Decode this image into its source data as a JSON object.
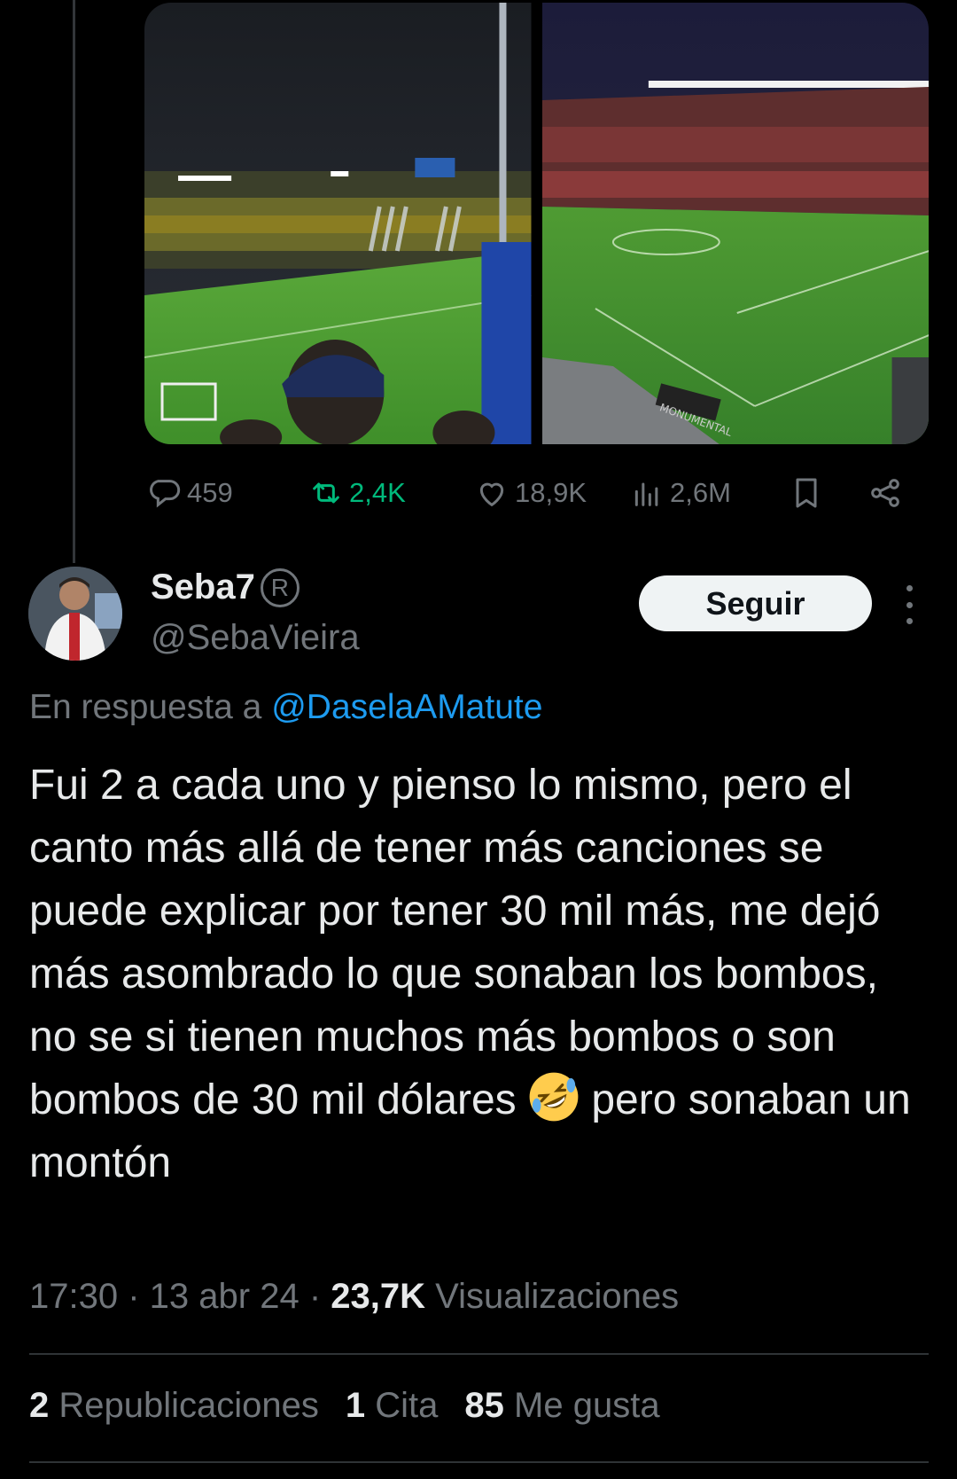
{
  "parent_tweet": {
    "actions": {
      "replies": "459",
      "retweets": "2,4K",
      "likes": "18,9K",
      "views": "2,6M"
    },
    "media_banner_text": "MONUMENTAL"
  },
  "tweet": {
    "display_name": "Seba7",
    "badge": "R",
    "handle": "@SebaVieira",
    "follow_label": "Seguir",
    "reply_prefix": "En respuesta a",
    "reply_mention": "@DaselaAMatute",
    "text_before_emoji": "Fui 2 a cada uno y pienso lo mismo, pero el canto más allá de tener más canciones se puede explicar por tener 30 mil más, me dejó más asombrado lo que sonaban los bombos, no se si tienen muchos más bombos o son bombos de 30 mil dólares",
    "emoji": "rolling-on-the-floor-laughing",
    "text_after_emoji": "pero sonaban un montón",
    "time": "17:30",
    "date": "13 abr 24",
    "views_count": "23,7K",
    "views_label": "Visualizaciones",
    "stats": {
      "reposts_count": "2",
      "reposts_label": "Republicaciones",
      "quotes_count": "1",
      "quotes_label": "Cita",
      "likes_count": "85",
      "likes_label": "Me gusta"
    }
  },
  "colors": {
    "background": "#000000",
    "text": "#e7e9ea",
    "secondary": "#71767b",
    "accent": "#1d9bf0",
    "retweet_green": "#00ba7c",
    "pitch": "#3c9a2c"
  }
}
